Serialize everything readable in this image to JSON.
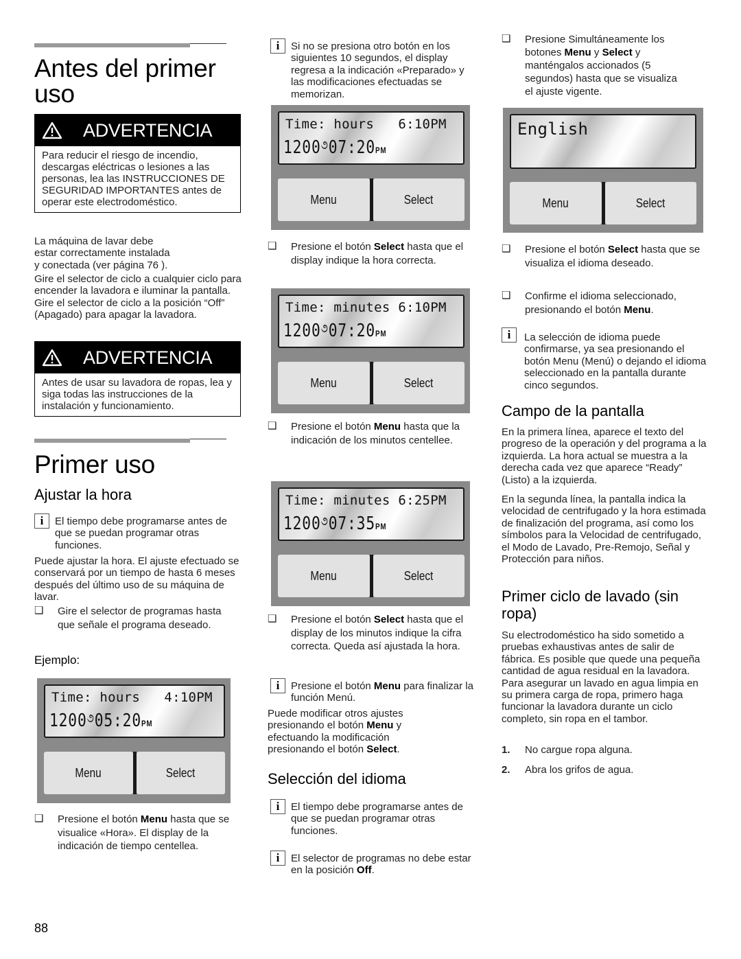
{
  "page_number": "88",
  "col1": {
    "title": "Antes del primer uso",
    "warning1": {
      "label": "ADVERTENCIA",
      "text": "Para reducir el riesgo de incendio, descargas eléctricas o lesiones a las personas, lea las INSTRUCCIONES DE SEGURIDAD IMPORTANTES antes de operar este electrodoméstico."
    },
    "install_lines": [
      "La máquina de lavar debe",
      "estar correctamente instalada",
      "y conectada (ver página 76 )."
    ],
    "selector_text": "Gire el selector de ciclo a cualquier ciclo para encender la lavadora e iluminar la pantalla.  Gire el selector de ciclo a la posición “Off” (Apagado) para apagar la lavadora.",
    "warning2": {
      "label": "ADVERTENCIA",
      "text": "Antes de usar su lavadora de ropas, lea y siga todas las instrucciones de la instalación y funcionamiento."
    },
    "section_title": "Primer uso",
    "subsection_title": "Ajustar la hora",
    "info1": "El tiempo debe programarse antes de que se puedan programar otras funciones.",
    "adjust_text": "Puede ajustar la hora. El ajuste efectuado se conservará por un tiempo de hasta 6 meses después del último uso de su máquina de lavar.",
    "bullet1": "Gire el selector de programas hasta que señale el programa deseado.",
    "example_label": "Ejemplo:",
    "display1": {
      "line1": "Time: hours   4:10PM",
      "spin": "1200",
      "time": "05:20",
      "suffix": "PM",
      "menu": "Menu",
      "select": "Select"
    },
    "bullet2": {
      "pre": "Presione el botón ",
      "bold": "Menu",
      "post": " hasta que se visualice «Hora». El display de la indicación de tiempo centellea."
    }
  },
  "col2": {
    "info1": "Si no se presiona otro botón en los siguientes 10 segundos, el display regresa a la indicación «Preparado» y las modificaciones efectuadas se memorizan.",
    "display1": {
      "line1": "Time: hours   6:10PM",
      "spin": "1200",
      "time": "07:20",
      "suffix": "PM",
      "menu": "Menu",
      "select": "Select"
    },
    "bullet1": {
      "pre": "Presione el botón ",
      "bold": "Select",
      "post": " hasta que el display indique la hora correcta."
    },
    "display2": {
      "line1": "Time: minutes 6:10PM",
      "spin": "1200",
      "time": "07:20",
      "suffix": "PM",
      "menu": "Menu",
      "select": "Select"
    },
    "bullet2": {
      "pre": "Presione el botón ",
      "bold": "Menu",
      "post": " hasta que la indicación de los minutos centellee."
    },
    "display3": {
      "line1": "Time: minutes 6:25PM",
      "spin": "1200",
      "time": "07:35",
      "suffix": "PM",
      "menu": "Menu",
      "select": "Select"
    },
    "bullet3": {
      "pre": "Presione el botón ",
      "bold": "Select",
      "post": " hasta que el display de los minutos indique la cifra correcta. Queda así ajustada la hora."
    },
    "info2": {
      "pre": "Presione el botón ",
      "bold": "Menu",
      "post": " para finalizar la función Menú."
    },
    "modify": {
      "pre": "Puede modificar otros ajustes presionando el botón ",
      "bold1": "Menu",
      "mid": " y efectuando la modificación presionando el botón ",
      "bold2": "Select",
      "post": "."
    },
    "lang_title": "Selección del idioma",
    "info3": "El tiempo debe programarse antes de que se puedan programar otras funciones.",
    "info4": {
      "pre": "El selector de programas no debe estar en la posición ",
      "bold": "Off",
      "post": "."
    }
  },
  "col3": {
    "bullet1": {
      "pre": "Presione Simultáneamente los botones ",
      "bold1": "Menu",
      "mid": " y ",
      "bold2": "Select",
      "post": " y manténgalos accionados (5 segundos) hasta que se visualiza el ajuste vigente."
    },
    "display": {
      "line1": "English",
      "menu": "Menu",
      "select": "Select"
    },
    "bullet2": {
      "pre": "Presione el botón ",
      "bold": "Select",
      "post": " hasta que se visualiza el idioma deseado."
    },
    "bullet3": {
      "pre": "Confirme el idioma seleccionado, presionando el botón ",
      "bold": "Menu",
      "post": "."
    },
    "info1": "La selección de idioma puede confirmarse, ya sea presionando el botón Menu (Menú) o dejando el idioma seleccionado en la pantalla durante cinco segundos.",
    "display_field_title": "Campo de la pantalla",
    "display_field_p1": "En la primera línea, aparece el texto del progreso de la operación y del programa a la izquierda. La hora actual se muestra a la derecha cada vez que aparece “Ready” (Listo) a la izquierda.",
    "display_field_p2": "En la segunda línea, la pantalla indica la velocidad de centrifugado y la hora estimada de finalización del programa, así como los símbolos para la Velocidad de centrifugado, el Modo de Lavado, Pre-Remojo, Señal y Protección para niños.",
    "first_cycle_title": "Primer ciclo de lavado (sin ropa)",
    "first_cycle_text": "Su electrodoméstico ha sido sometido a pruebas exhaustivas antes de salir de fábrica.  Es posible que quede una pequeña cantidad de agua residual en la lavadora.  Para asegurar un lavado en agua limpia en su primera carga de ropa, primero haga funcionar la lavadora durante un ciclo completo, sin ropa en el tambor.",
    "steps": [
      {
        "n": "1.",
        "text": "No cargue ropa alguna."
      },
      {
        "n": "2.",
        "text": "Abra los grifos de agua."
      }
    ]
  }
}
